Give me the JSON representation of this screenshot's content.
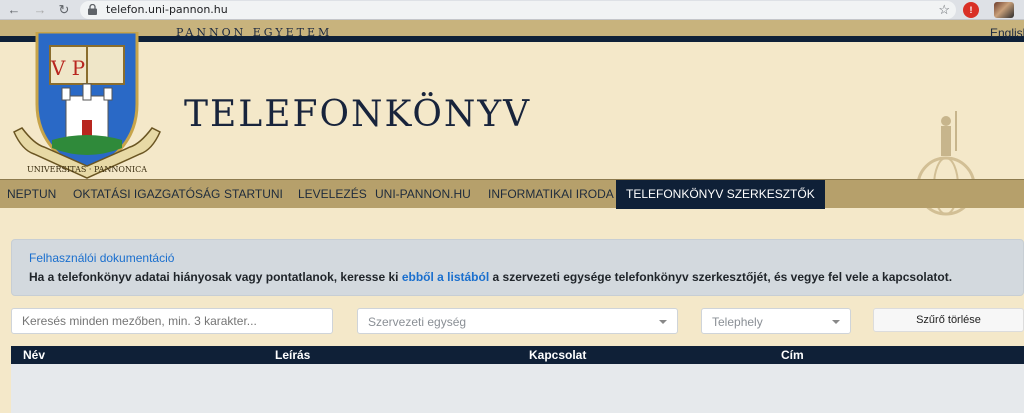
{
  "browser": {
    "url": "telefon.uni-pannon.hu"
  },
  "top_bar": {
    "university_name": "PANNON EGYETEM",
    "language_link": "English"
  },
  "header": {
    "title": "TELEFONKÖNYV",
    "crest": {
      "letters": "V P",
      "motto": "UNIVERSITAS · PANNONICA"
    }
  },
  "nav": {
    "items": [
      {
        "label": "NEPTUN"
      },
      {
        "label": "OKTATÁSI IGAZGATÓSÁG"
      },
      {
        "label": "STARTUNI"
      },
      {
        "label": "LEVELEZÉS"
      },
      {
        "label": "UNI-PANNON.HU"
      },
      {
        "label": "INFORMATIKAI IRODA"
      },
      {
        "label": "TELEFONKÖNYV SZERKESZTŐK",
        "active": true
      }
    ]
  },
  "info": {
    "doc_link": "Felhasználói dokumentáció",
    "text_before": "Ha a telefonkönyv adatai hiányosak vagy pontatlanok, keresse ki ",
    "link": "ebből a listából",
    "text_after": " a szervezeti egysége telefonkönyv szerkesztőjét, és vegye fel vele a kapcsolatot."
  },
  "filters": {
    "search_placeholder": "Keresés minden mezőben, min. 3 karakter...",
    "unit_placeholder": "Szervezeti egység",
    "site_placeholder": "Telephely",
    "clear_label": "Szűrő törlése"
  },
  "table": {
    "columns": [
      "Név",
      "Leírás",
      "Kapcsolat",
      "Cím"
    ]
  },
  "colors": {
    "navy": "#0f2037",
    "gold": "#c8b37d",
    "nav_bg": "#b6a06b",
    "page_bg": "#f4e8c9",
    "link": "#1a6fce"
  }
}
